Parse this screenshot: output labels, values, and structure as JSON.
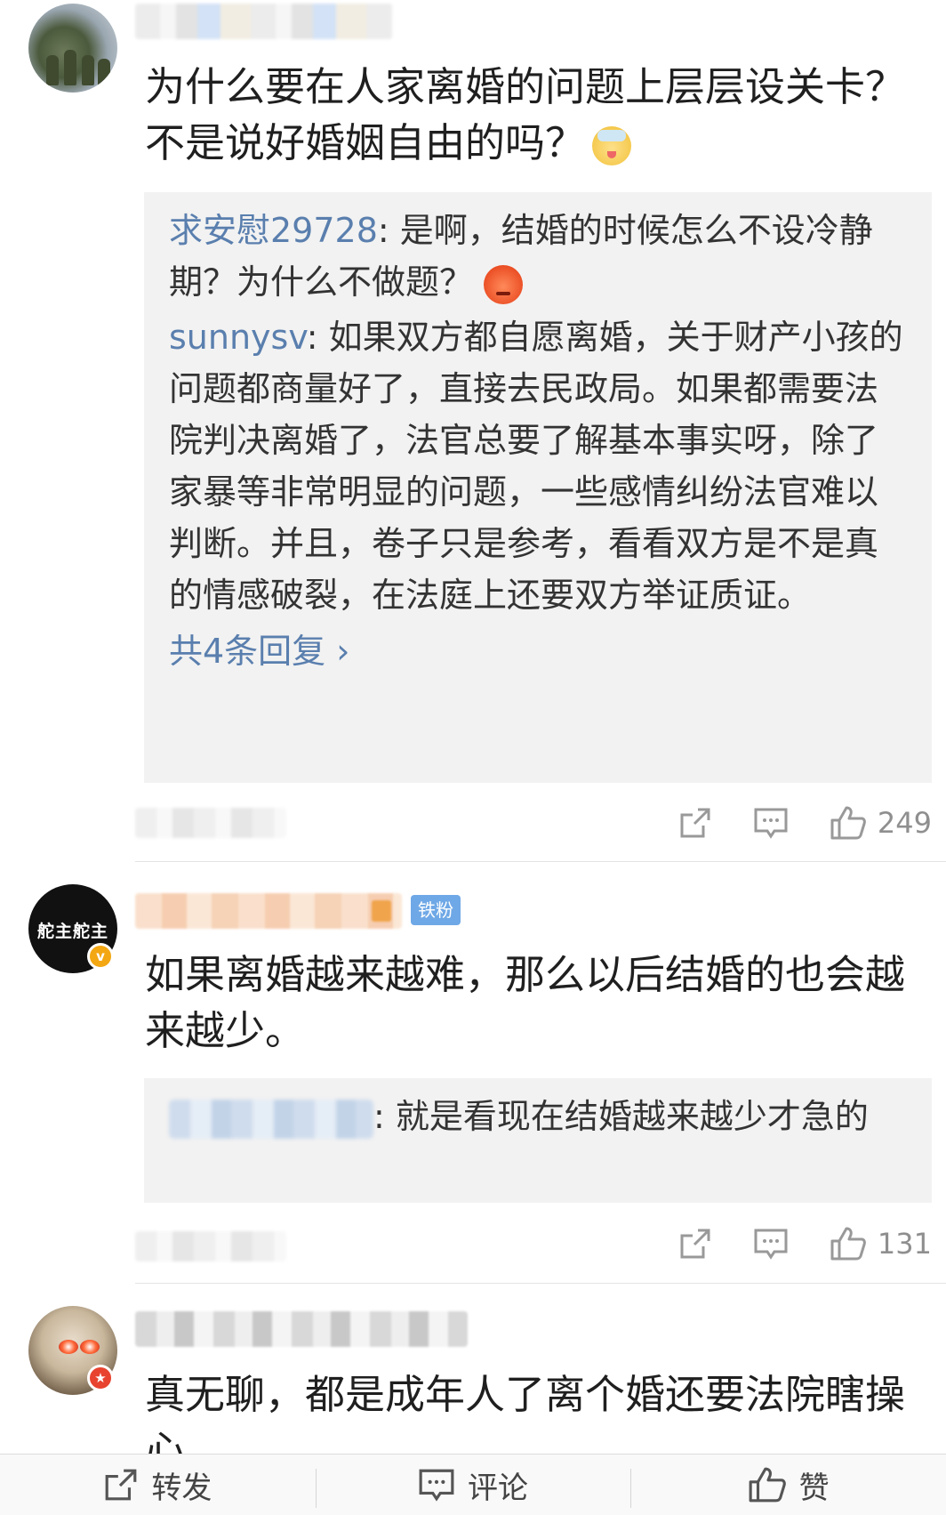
{
  "comments": [
    {
      "text": "为什么要在人家离婚的问题上层层设关卡？不是说好婚姻自由的吗？",
      "emoji": "sick-face-emoji",
      "replies": [
        {
          "author": "求安慰29728",
          "text": ": 是啊，结婚的时候怎么不设冷静期？为什么不做题？",
          "emoji": "angry-face-emoji"
        },
        {
          "author": "sunnysv",
          "text": ": 如果双方都自愿离婚，关于财产小孩的问题都商量好了，直接去民政局。如果都需要法院判决离婚了，法官总要了解基本事实呀，除了家暴等非常明显的问题，一些感情纠纷法官难以判断。并且，卷子只是参考，看看双方是不是真的情感破裂，在法庭上还要双方举证质证。"
        }
      ],
      "more_replies": "共4条回复 ›",
      "likes": "249"
    },
    {
      "avatar_text": "舵主舵主",
      "badge": "铁粉",
      "text": "如果离婚越来越难，那么以后结婚的也会越来越少。",
      "replies": [
        {
          "author": "",
          "text": ": 就是看现在结婚越来越少才急的"
        }
      ],
      "likes": "131"
    },
    {
      "text": "真无聊，都是成年人了离个婚还要法院瞎操心"
    }
  ],
  "bottom_bar": {
    "repost": "转发",
    "comment": "评论",
    "like": "赞"
  },
  "colors": {
    "link": "#5a7fae",
    "reply_bg": "#f2f2f2",
    "verified_gold": "#f3a712",
    "fan_badge": "#6fa8e6"
  }
}
